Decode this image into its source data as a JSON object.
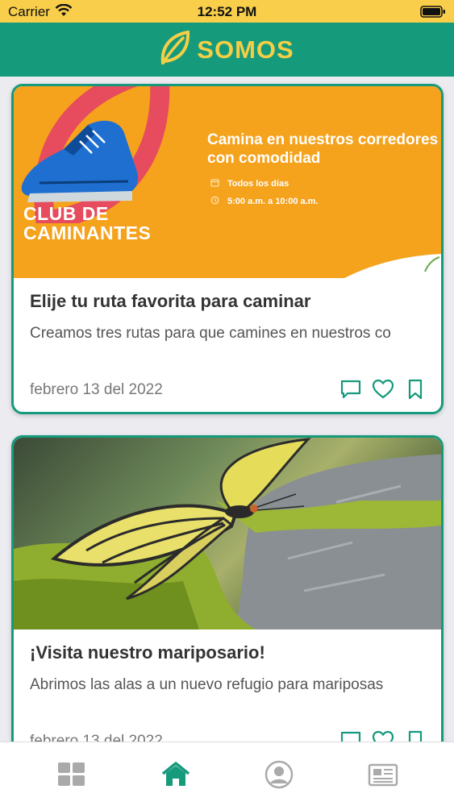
{
  "status_bar": {
    "carrier": "Carrier",
    "time": "12:52 PM"
  },
  "header": {
    "brand": "SOMOS",
    "logo_icon": "leaf-icon"
  },
  "colors": {
    "primary": "#169a7c",
    "accent": "#f4cf45",
    "banner_orange": "#f5a21c"
  },
  "feed": {
    "cards": [
      {
        "title": "Elije tu ruta favorita para caminar",
        "description": "Creamos tres rutas para que camines en nuestros co",
        "date": "febrero 13 del 2022",
        "banner": {
          "club_title": "CLUB DE CAMINANTES",
          "headline": "Camina en nuestros corredores con comodidad",
          "schedule_days": "Todos los días",
          "schedule_hours": "5:00 a.m. a 10:00 a.m."
        }
      },
      {
        "title": "¡Visita nuestro mariposario!",
        "description": "Abrimos las alas a un nuevo refugio para mariposas",
        "date": "febrero 13 del 2022"
      }
    ],
    "action_icons": [
      "comment-icon",
      "heart-icon",
      "bookmark-icon"
    ]
  },
  "tab_bar": {
    "tabs": [
      {
        "icon": "grid-icon",
        "active": false
      },
      {
        "icon": "home-icon",
        "active": true
      },
      {
        "icon": "profile-icon",
        "active": false
      },
      {
        "icon": "news-icon",
        "active": false
      }
    ]
  }
}
